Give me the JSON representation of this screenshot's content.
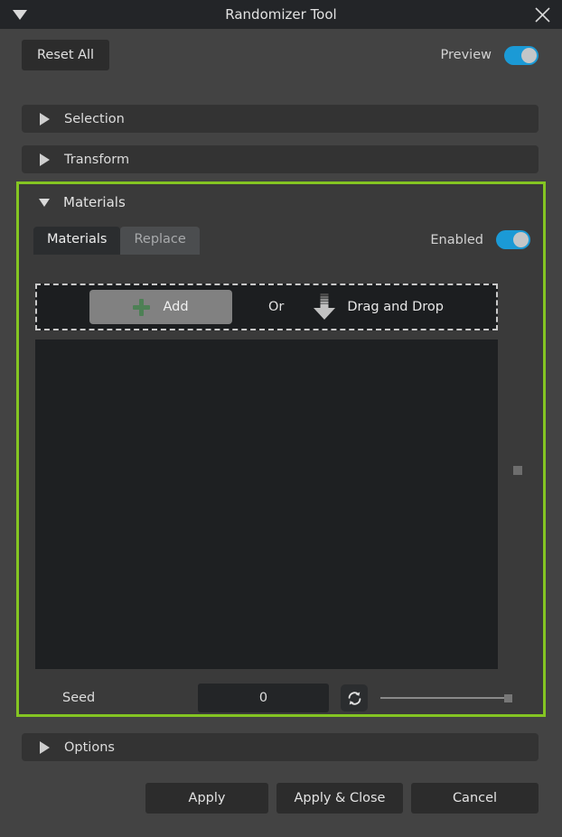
{
  "window": {
    "title": "Randomizer Tool",
    "collapse_icon": "triangle-down-icon",
    "close_icon": "close-x-icon"
  },
  "toolbar": {
    "reset_label": "Reset All",
    "preview_label": "Preview",
    "preview_enabled": true
  },
  "sections": [
    {
      "label": "Selection",
      "expanded": false,
      "icon": "triangle-right-icon"
    },
    {
      "label": "Transform",
      "expanded": false,
      "icon": "triangle-right-icon"
    },
    {
      "label": "Options",
      "expanded": false,
      "icon": "triangle-right-icon"
    }
  ],
  "materials": {
    "title": "Materials",
    "expanded": true,
    "highlight_color": "#84c522",
    "enabled_label": "Enabled",
    "enabled": true,
    "tabs": [
      {
        "label": "Materials",
        "active": true
      },
      {
        "label": "Replace",
        "active": false
      }
    ],
    "dropzone": {
      "add_label": "Add",
      "add_icon": "plus-icon",
      "or_label": "Or",
      "drag_icon": "arrow-down-icon",
      "drag_label": "Drag and Drop"
    },
    "list_items": [],
    "seed": {
      "label": "Seed",
      "value": "0",
      "refresh_icon": "refresh-icon",
      "slider_value": 100
    }
  },
  "footer": {
    "apply_label": "Apply",
    "apply_close_label": "Apply & Close",
    "cancel_label": "Cancel"
  },
  "colors": {
    "accent_toggle": "#1b9ad6",
    "highlight_border": "#84c522",
    "plus_green": "#4d8055",
    "window_bg": "#434343",
    "titlebar_bg": "#232528"
  }
}
